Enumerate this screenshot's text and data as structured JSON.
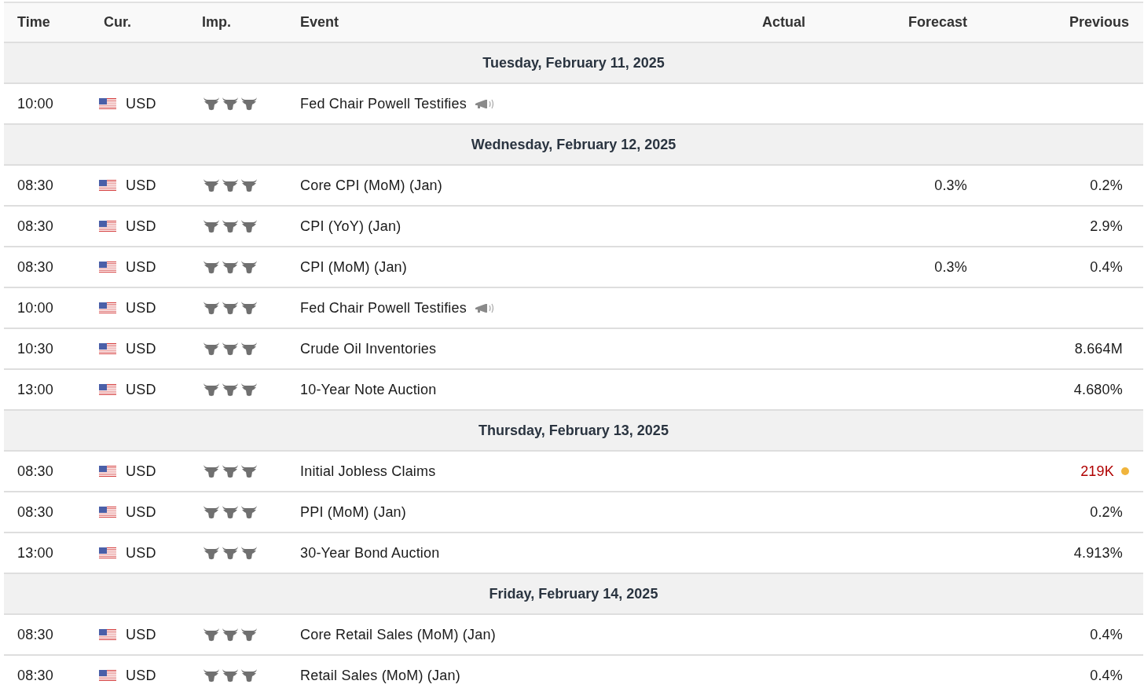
{
  "table": {
    "columns": [
      {
        "label": "Time"
      },
      {
        "label": "Cur."
      },
      {
        "label": "Imp."
      },
      {
        "label": "Event"
      },
      {
        "label": "Actual"
      },
      {
        "label": "Forecast"
      },
      {
        "label": "Previous"
      }
    ],
    "groups": [
      {
        "date": "Tuesday, February 11, 2025",
        "rows": [
          {
            "time": "10:00",
            "currency": "USD",
            "stars": 3,
            "event": "Fed Chair Powell Testifies",
            "speech": true
          }
        ]
      },
      {
        "date": "Wednesday, February 12, 2025",
        "rows": [
          {
            "time": "08:30",
            "currency": "USD",
            "stars": 3,
            "event": "Core CPI (MoM) (Jan)",
            "forecast": "0.3%",
            "previous": "0.2%"
          },
          {
            "time": "08:30",
            "currency": "USD",
            "stars": 3,
            "event": "CPI (YoY) (Jan)",
            "previous": "2.9%"
          },
          {
            "time": "08:30",
            "currency": "USD",
            "stars": 3,
            "event": "CPI (MoM) (Jan)",
            "forecast": "0.3%",
            "previous": "0.4%"
          },
          {
            "time": "10:00",
            "currency": "USD",
            "stars": 3,
            "event": "Fed Chair Powell Testifies",
            "speech": true
          },
          {
            "time": "10:30",
            "currency": "USD",
            "stars": 3,
            "event": "Crude Oil Inventories",
            "previous": "8.664M"
          },
          {
            "time": "13:00",
            "currency": "USD",
            "stars": 3,
            "event": "10-Year Note Auction",
            "previous": "4.680%"
          }
        ]
      },
      {
        "date": "Thursday, February 13, 2025",
        "rows": [
          {
            "time": "08:30",
            "currency": "USD",
            "stars": 3,
            "event": "Initial Jobless Claims",
            "previous": "219K",
            "previous_revised": true
          },
          {
            "time": "08:30",
            "currency": "USD",
            "stars": 3,
            "event": "PPI (MoM) (Jan)",
            "previous": "0.2%"
          },
          {
            "time": "13:00",
            "currency": "USD",
            "stars": 3,
            "event": "30-Year Bond Auction",
            "previous": "4.913%"
          }
        ]
      },
      {
        "date": "Friday, February 14, 2025",
        "rows": [
          {
            "time": "08:30",
            "currency": "USD",
            "stars": 3,
            "event": "Core Retail Sales (MoM) (Jan)",
            "previous": "0.4%"
          },
          {
            "time": "08:30",
            "currency": "USD",
            "stars": 3,
            "event": "Retail Sales (MoM) (Jan)",
            "previous": "0.4%"
          }
        ]
      }
    ]
  }
}
